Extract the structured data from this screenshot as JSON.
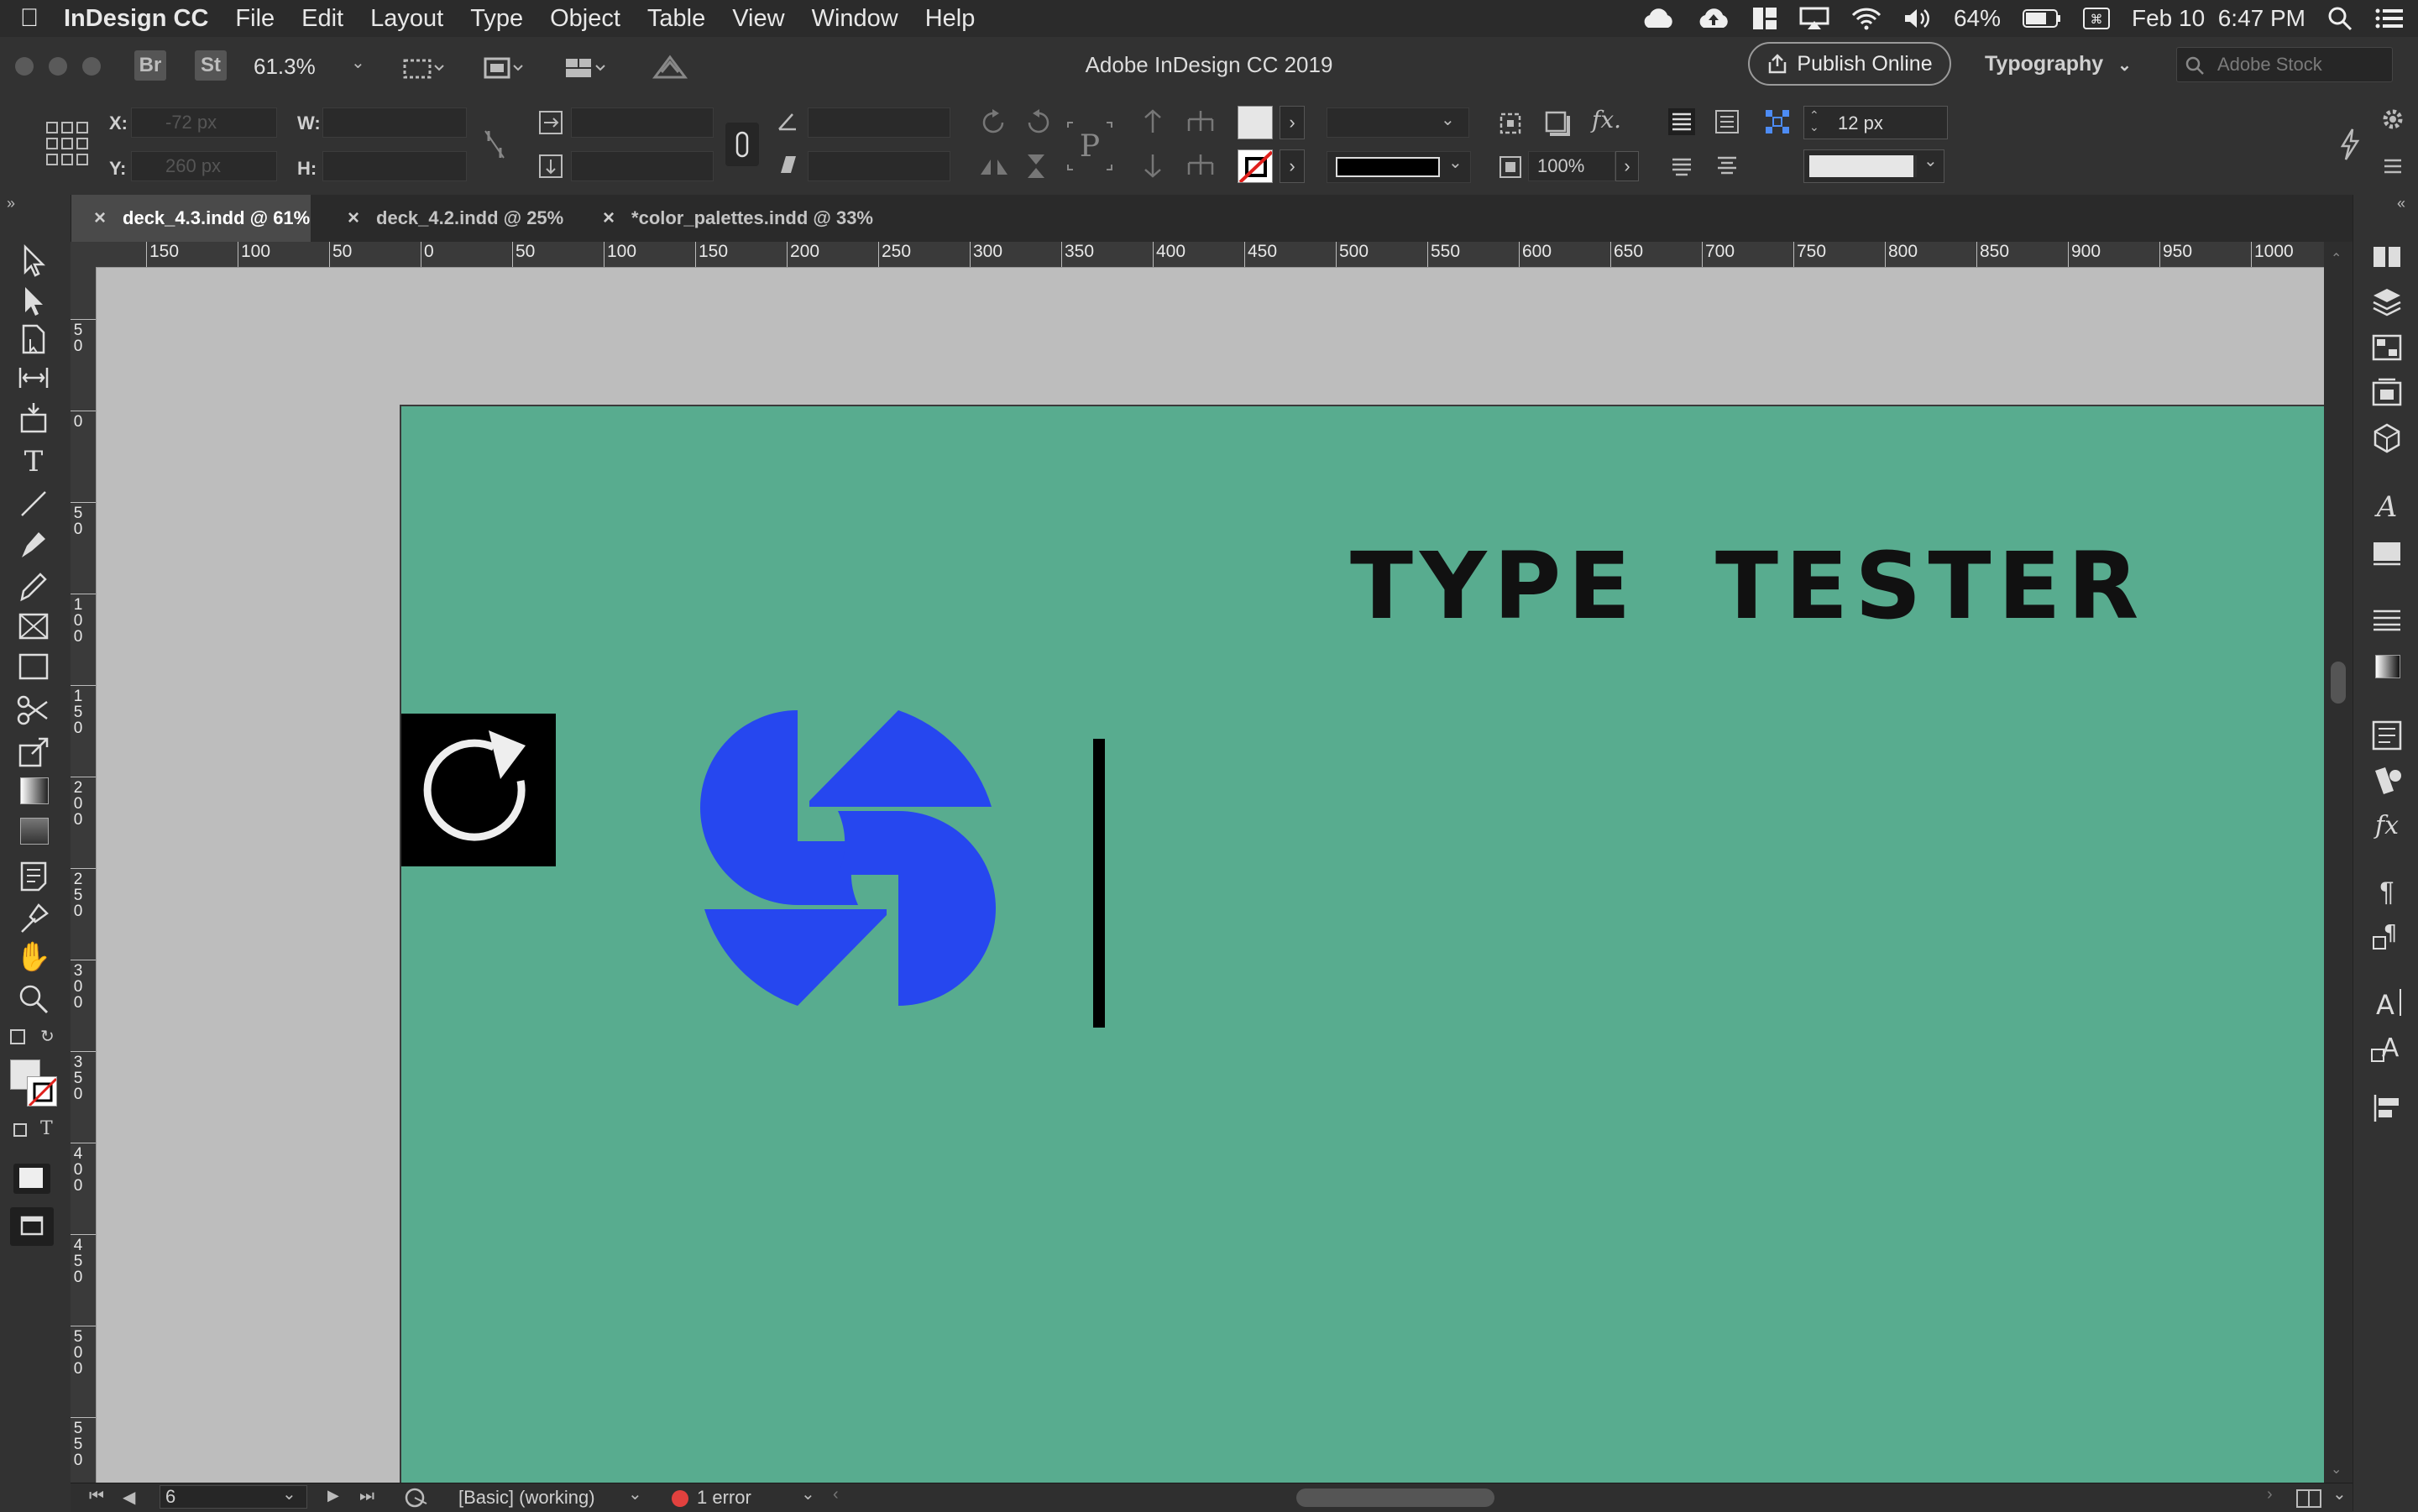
{
  "menubar": {
    "app_name": "InDesign CC",
    "items": [
      "File",
      "Edit",
      "Layout",
      "Type",
      "Object",
      "Table",
      "View",
      "Window",
      "Help"
    ],
    "battery": "64%",
    "datetime": "Feb 10  6:47 PM"
  },
  "appbar": {
    "bridge_label": "Br",
    "stock_label": "St",
    "zoom": "61.3%",
    "title": "Adobe InDesign CC 2019",
    "publish_label": "Publish Online",
    "workspace": "Typography",
    "stock_search_placeholder": "Adobe Stock"
  },
  "control": {
    "x_label": "X:",
    "y_label": "Y:",
    "w_label": "W:",
    "h_label": "H:",
    "x_value": "-72 px",
    "y_value": "260 px",
    "stroke_weight": "12 px",
    "opacity": "100%"
  },
  "tabs": [
    {
      "label": "deck_4.3.indd @ 61%",
      "active": true
    },
    {
      "label": "deck_4.2.indd @ 25%",
      "active": false
    },
    {
      "label": "*color_palettes.indd @ 33%",
      "active": false
    }
  ],
  "ruler": {
    "h_ticks": [
      "150",
      "100",
      "50",
      "0",
      "50",
      "100",
      "150",
      "200",
      "250",
      "300",
      "350",
      "400",
      "450",
      "500",
      "550",
      "600",
      "650",
      "700",
      "750",
      "800",
      "850",
      "900",
      "950",
      "1000"
    ],
    "v_ticks": [
      "50",
      "0",
      "50",
      "100",
      "150",
      "200",
      "250",
      "300",
      "350",
      "400",
      "450",
      "500",
      "550"
    ]
  },
  "document": {
    "heading": "TYPE  TESTER",
    "logo_color": "#2647ef",
    "page_color": "#58ac8f"
  },
  "status": {
    "page_number": "6",
    "style": "[Basic] (working)",
    "errors": "1 error"
  }
}
